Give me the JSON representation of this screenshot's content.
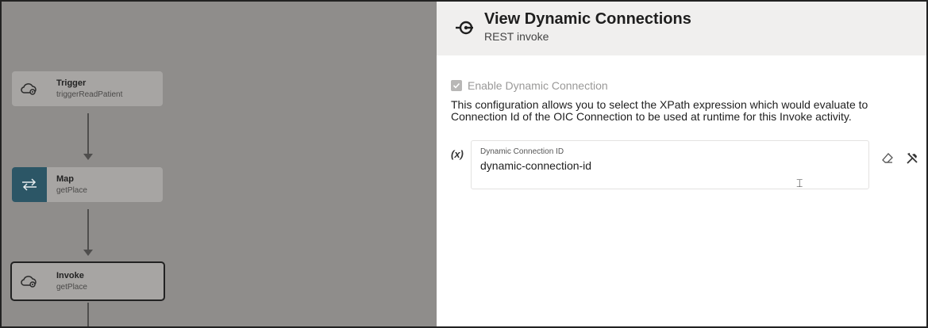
{
  "flow": {
    "nodes": [
      {
        "title": "Trigger",
        "subtitle": "triggerReadPatient",
        "icon": "cloud-gear-icon"
      },
      {
        "title": "Map",
        "subtitle": "getPlace",
        "icon": "swap-arrows-icon"
      },
      {
        "title": "Invoke",
        "subtitle": "getPlace",
        "icon": "cloud-gear-icon"
      }
    ]
  },
  "panel": {
    "title": "View Dynamic Connections",
    "subtitle": "REST invoke",
    "header_icon": "connection-plug-icon",
    "checkbox_label": "Enable Dynamic Connection",
    "checkbox_checked": true,
    "description": "This configuration allows you to select the XPath expression which would evaluate to Connection Id of the OIC Connection to be used at runtime for this Invoke activity.",
    "variable_marker": "(x)",
    "field": {
      "label": "Dynamic Connection ID",
      "value": "dynamic-connection-id"
    },
    "tools": [
      "eraser-icon",
      "tools-icon"
    ]
  },
  "colors": {
    "canvas_bg": "#8f8d8b",
    "node_bg": "#a7a5a3",
    "map_icon_bg": "#2c5666",
    "panel_header_bg": "#f0efee"
  }
}
